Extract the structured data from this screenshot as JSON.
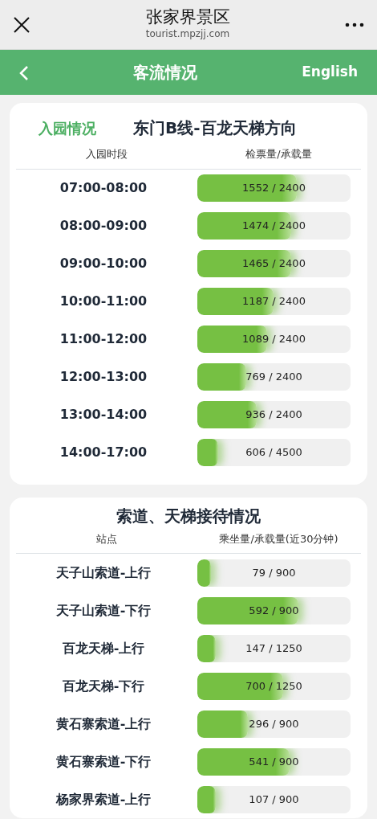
{
  "browser_bar": {
    "title": "张家界景区",
    "url": "tourist.mpzjj.com"
  },
  "header": {
    "title": "客流情况",
    "language_button": "English"
  },
  "entry_section": {
    "tag": "入园情况",
    "title": "东门B线-百龙天梯方向",
    "columns": [
      "入园时段",
      "检票量/承载量"
    ],
    "rows": [
      {
        "label": "07:00-08:00",
        "reading": "1552 / 2400",
        "level": 0.647
      },
      {
        "label": "08:00-09:00",
        "reading": "1474 / 2400",
        "level": 0.614
      },
      {
        "label": "09:00-10:00",
        "reading": "1465 / 2400",
        "level": 0.61
      },
      {
        "label": "10:00-11:00",
        "reading": "1187 / 2400",
        "level": 0.495
      },
      {
        "label": "11:00-12:00",
        "reading": "1089 / 2400",
        "level": 0.454
      },
      {
        "label": "12:00-13:00",
        "reading": "769 / 2400",
        "level": 0.32
      },
      {
        "label": "13:00-14:00",
        "reading": "936 / 2400",
        "level": 0.39
      },
      {
        "label": "14:00-17:00",
        "reading": "606 / 4500",
        "level": 0.135
      }
    ]
  },
  "ropeway_section": {
    "title": "索道、天梯接待情况",
    "columns": [
      "站点",
      "乘坐量/承载量(近30分钟)"
    ],
    "rows": [
      {
        "label": "天子山索道-上行",
        "reading": "79 / 900",
        "level": 0.088
      },
      {
        "label": "天子山索道-下行",
        "reading": "592 / 900",
        "level": 0.658
      },
      {
        "label": "百龙天梯-上行",
        "reading": "147 / 1250",
        "level": 0.118
      },
      {
        "label": "百龙天梯-下行",
        "reading": "700 / 1250",
        "level": 0.56
      },
      {
        "label": "黄石寨索道-上行",
        "reading": "296 / 900",
        "level": 0.329
      },
      {
        "label": "黄石寨索道-下行",
        "reading": "541 / 900",
        "level": 0.601
      },
      {
        "label": "杨家界索道-上行",
        "reading": "107 / 900",
        "level": 0.119
      }
    ]
  }
}
